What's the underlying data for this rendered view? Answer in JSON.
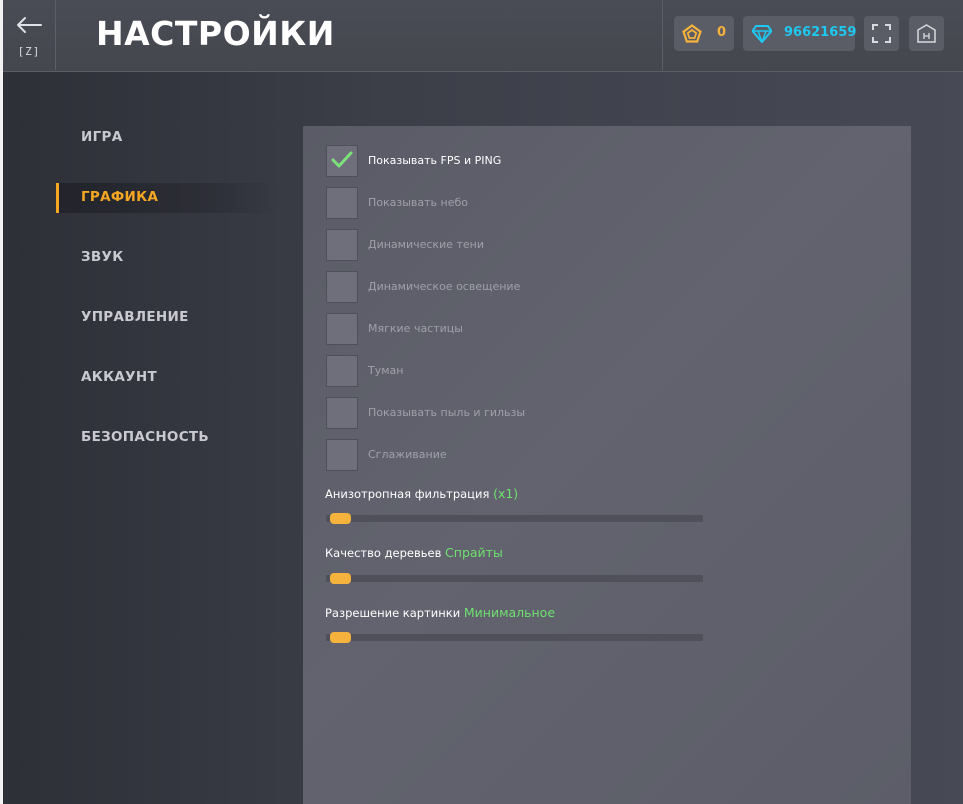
{
  "header": {
    "back_key": "[Z]",
    "title": "НАСТРОЙКИ",
    "coins": "0",
    "gems": "96621659"
  },
  "icons": {
    "back": "arrow-left-icon",
    "coin": "pentagon-coin-icon",
    "gem": "diamond-icon",
    "fullscreen": "fullscreen-icon",
    "hud": "hud-icon",
    "check": "checkmark-icon"
  },
  "colors": {
    "accent": "#f5a623",
    "gem": "#1ec8f0",
    "value_green": "#6ee06e"
  },
  "sidebar": {
    "items": [
      {
        "label": "ИГРА",
        "active": false
      },
      {
        "label": "ГРАФИКА",
        "active": true
      },
      {
        "label": "ЗВУК",
        "active": false
      },
      {
        "label": "УПРАВЛЕНИЕ",
        "active": false
      },
      {
        "label": "АККАУНТ",
        "active": false
      },
      {
        "label": "БЕЗОПАСНОСТЬ",
        "active": false
      }
    ]
  },
  "settings": {
    "checkboxes": [
      {
        "label": "Показывать FPS и PING",
        "checked": true
      },
      {
        "label": "Показывать небо",
        "checked": false
      },
      {
        "label": "Динамические тени",
        "checked": false
      },
      {
        "label": "Динамическое освещение",
        "checked": false
      },
      {
        "label": "Мягкие частицы",
        "checked": false
      },
      {
        "label": "Туман",
        "checked": false
      },
      {
        "label": "Показывать пыль и гильзы",
        "checked": false
      },
      {
        "label": "Сглаживание",
        "checked": false
      }
    ],
    "sliders": [
      {
        "label": "Анизотропная фильтрация",
        "value_text": "(x1)",
        "level": 0
      },
      {
        "label": "Качество деревьев",
        "value_text": "Спрайты",
        "level": 0
      },
      {
        "label": "Разрешение картинки",
        "value_text": "Минимальное",
        "level": 0
      }
    ]
  }
}
